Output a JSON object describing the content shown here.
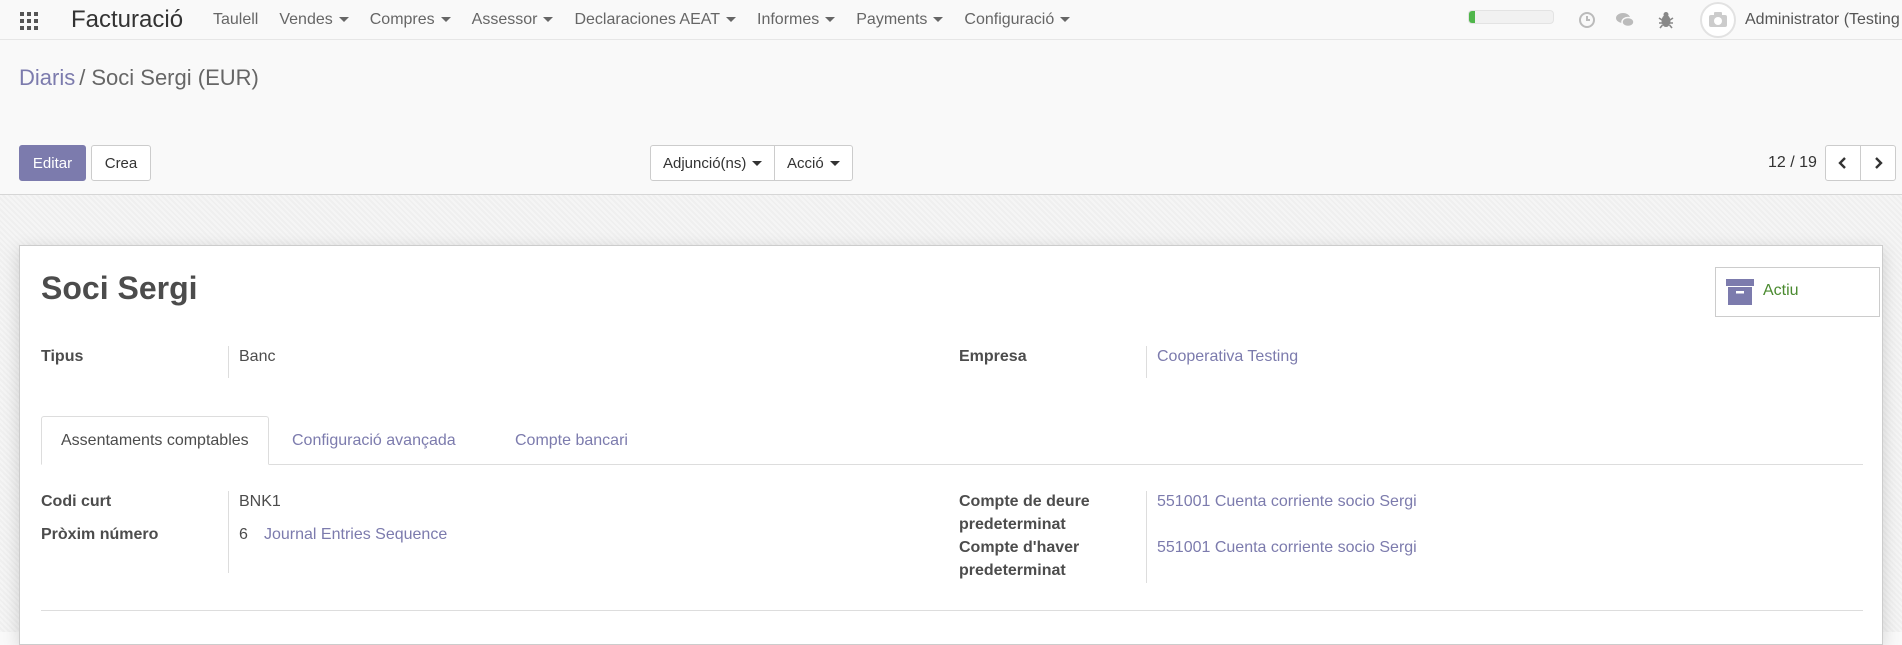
{
  "navbar": {
    "app_name": "Facturació",
    "menu": [
      "Taulell",
      "Vendes",
      "Compres",
      "Assessor",
      "Declaraciones AEAT",
      "Informes",
      "Payments",
      "Configuració"
    ],
    "progress_fraction": 0.07,
    "user_name": "Administrator (Testing"
  },
  "breadcrumb": {
    "parent": "Diaris",
    "current": "Soci Sergi (EUR)"
  },
  "buttons": {
    "edit": "Editar",
    "create": "Crea",
    "attachments": "Adjunció(ns)",
    "action": "Acció"
  },
  "pager": {
    "value": "12 / 19"
  },
  "form": {
    "title": "Soci Sergi",
    "status_button": "Actiu",
    "type_label": "Tipus",
    "type_value": "Banc",
    "company_label": "Empresa",
    "company_value": "Cooperativa Testing",
    "tabs": [
      "Assentaments comptables",
      "Configuració avançada",
      "Compte bancari"
    ],
    "code_label": "Codi curt",
    "code_value": "BNK1",
    "next_label": "Pròxim número",
    "next_value": "6",
    "sequence_link": "Journal Entries Sequence",
    "debit_label_1": "Compte de deure",
    "debit_label_2": "predeterminat",
    "debit_value": "551001 Cuenta corriente socio Sergi",
    "credit_label_1": "Compte d'haver",
    "credit_label_2": "predeterminat",
    "credit_value": "551001 Cuenta corriente socio Sergi"
  },
  "colors": {
    "primary": "#7c7bad",
    "active_green": "#4a8a2f",
    "progress": "#4fb64a"
  }
}
